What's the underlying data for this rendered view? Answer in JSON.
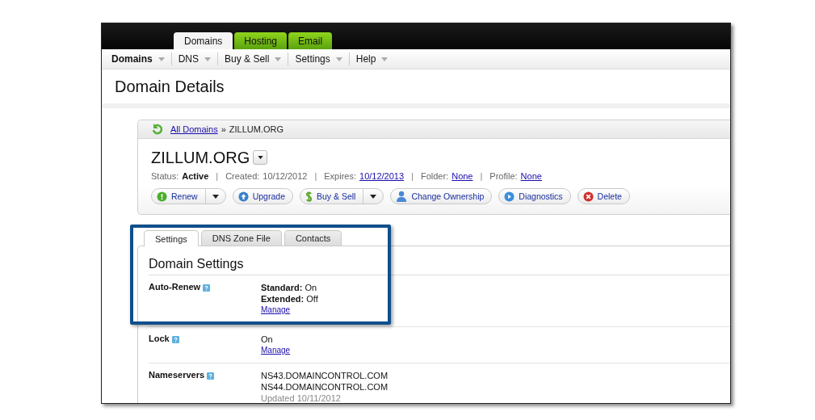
{
  "top_tabs": [
    {
      "label": "Domains",
      "selected": true
    },
    {
      "label": "Hosting",
      "selected": false
    },
    {
      "label": "Email",
      "selected": false
    }
  ],
  "menu": [
    {
      "label": "Domains",
      "selected": true
    },
    {
      "label": "DNS",
      "selected": false
    },
    {
      "label": "Buy & Sell",
      "selected": false
    },
    {
      "label": "Settings",
      "selected": false
    },
    {
      "label": "Help",
      "selected": false
    }
  ],
  "page_title": "Domain Details",
  "breadcrumb": {
    "link": "All Domains",
    "separator": "»",
    "current": "ZILLUM.ORG"
  },
  "domain": {
    "name": "ZILLUM.ORG",
    "meta": [
      {
        "label": "Status:",
        "value": "Active",
        "kind": "bold"
      },
      {
        "separator": "|",
        "label": "Created:",
        "value": "10/12/2012",
        "kind": "plain"
      },
      {
        "separator": "|",
        "label": "Expires:",
        "value": "10/12/2013",
        "kind": "link"
      },
      {
        "separator": "|",
        "label": "Folder:",
        "value": "None",
        "kind": "link"
      },
      {
        "separator": "|",
        "label": "Profile:",
        "value": "None",
        "kind": "link"
      }
    ]
  },
  "actions": [
    {
      "label": "Renew",
      "kind": "renew",
      "has_menu": true
    },
    {
      "label": "Upgrade",
      "kind": "upgrade",
      "has_menu": false
    },
    {
      "label": "Buy & Sell",
      "kind": "dollar",
      "has_menu": true
    },
    {
      "label": "Change Ownership",
      "kind": "person",
      "has_menu": false
    },
    {
      "label": "Diagnostics",
      "kind": "diagnostics",
      "has_menu": false
    },
    {
      "label": "Delete",
      "kind": "delete",
      "has_menu": false
    }
  ],
  "section_tabs": [
    {
      "label": "Settings",
      "selected": true
    },
    {
      "label": "DNS Zone File",
      "selected": false
    },
    {
      "label": "Contacts",
      "selected": false
    }
  ],
  "section_title": "Domain Settings",
  "settings": [
    {
      "label": "Auto-Renew",
      "lines": [
        {
          "text": "**Standard:** On",
          "kind": "plain"
        },
        {
          "text": "**Extended:** Off",
          "kind": "plain"
        }
      ],
      "link": "Manage",
      "highlighted": true
    },
    {
      "label": "Lock",
      "lines": [
        {
          "text": "On",
          "kind": "plain"
        }
      ],
      "link": "Manage",
      "highlighted": false
    },
    {
      "label": "Nameservers",
      "lines": [
        {
          "text": "NS43.DOMAINCONTROL.COM",
          "kind": "plain"
        },
        {
          "text": "NS44.DOMAINCONTROL.COM",
          "kind": "plain"
        },
        {
          "text": "Updated 10/11/2012",
          "kind": "muted"
        }
      ],
      "highlighted": false
    }
  ]
}
